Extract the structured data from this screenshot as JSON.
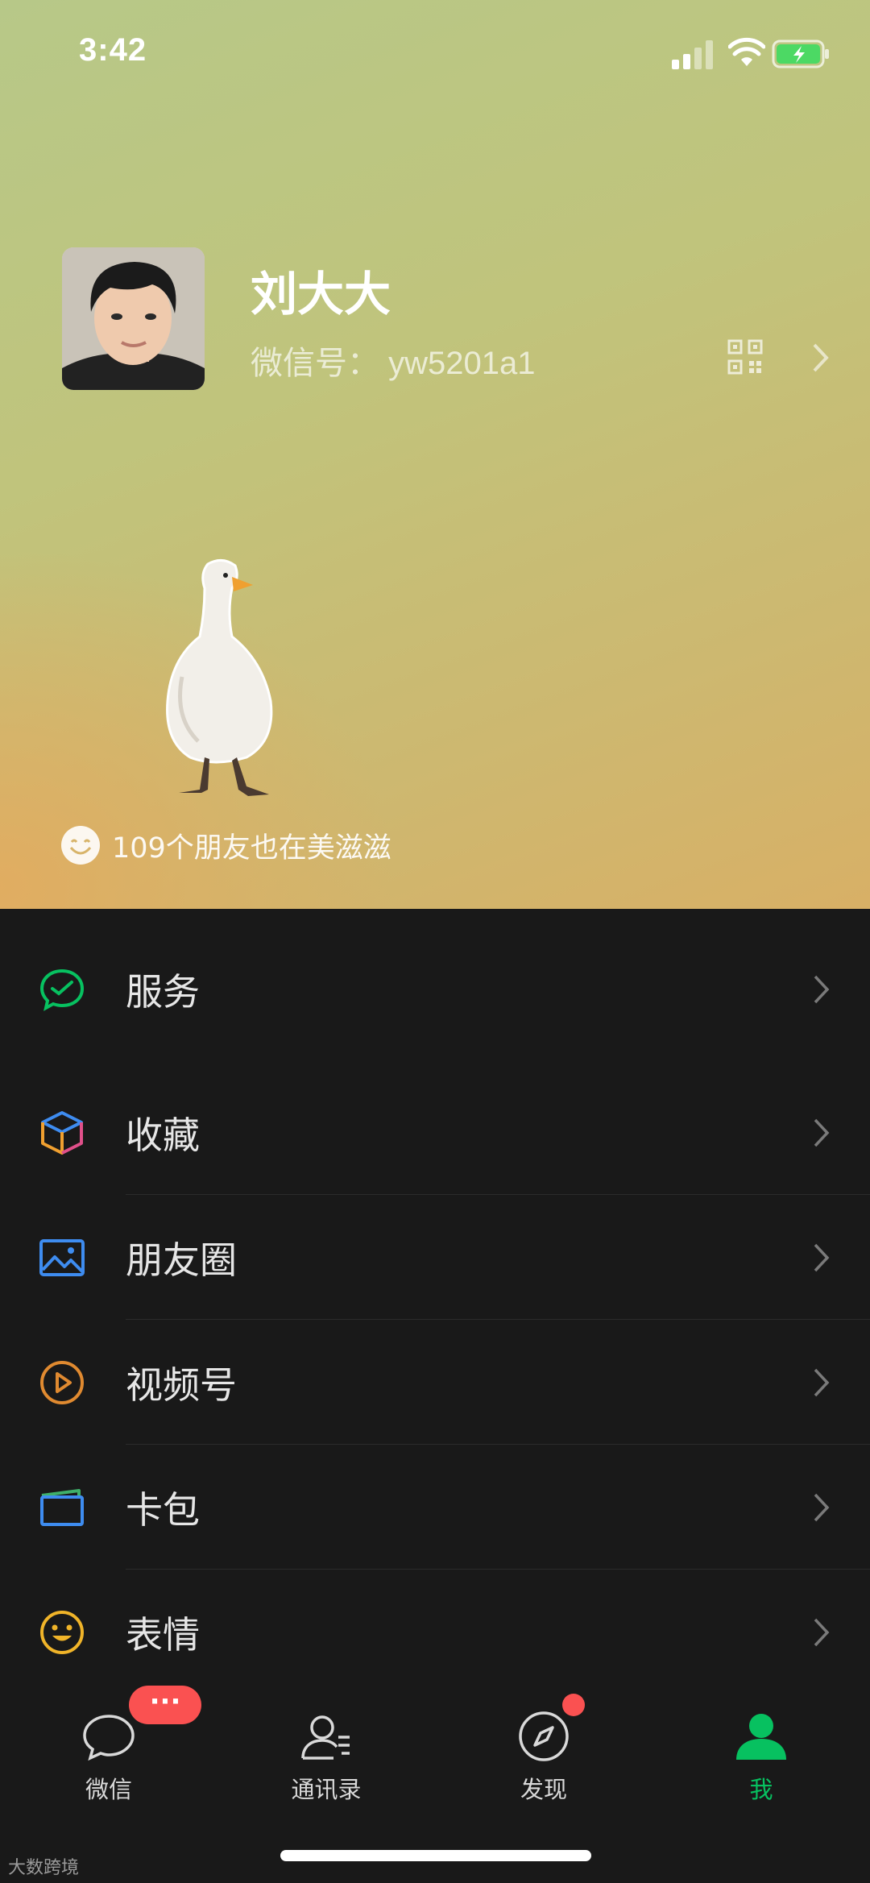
{
  "status_bar": {
    "time": "3:42"
  },
  "profile": {
    "name": "刘大大",
    "wechat_id": "微信号：  yw5201a1"
  },
  "friends_status": "109个朋友也在美滋滋",
  "menu": {
    "group1": [
      {
        "label": "服务",
        "icon": "service-icon"
      }
    ],
    "group2": [
      {
        "label": "收藏",
        "icon": "favorites-cube-icon"
      },
      {
        "label": "朋友圈",
        "icon": "moments-image-icon"
      },
      {
        "label": "视频号",
        "icon": "channels-play-icon"
      },
      {
        "label": "卡包",
        "icon": "card-wallet-icon"
      },
      {
        "label": "表情",
        "icon": "emoji-icon"
      }
    ]
  },
  "tabs": [
    {
      "label": "微信",
      "icon": "chat-bubble-icon",
      "active": false
    },
    {
      "label": "通讯录",
      "icon": "contacts-icon",
      "active": false
    },
    {
      "label": "发现",
      "icon": "compass-icon",
      "active": false
    },
    {
      "label": "我",
      "icon": "person-icon",
      "active": true
    }
  ],
  "badges": {
    "chats": "···"
  },
  "watermark": "大数跨境",
  "colors": {
    "accent": "#07c160",
    "badge": "#fa5151",
    "background": "#191919"
  }
}
